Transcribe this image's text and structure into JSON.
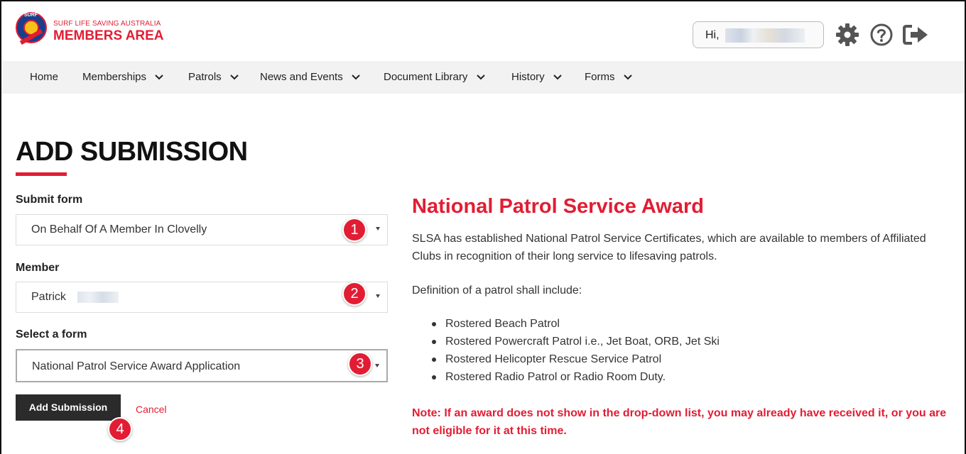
{
  "brand": {
    "sub_title": "SURF LIFE SAVING AUSTRALIA",
    "main_title": "MEMBERS AREA",
    "logo_text": "SURF"
  },
  "user": {
    "greeting": "Hi,"
  },
  "icons": {
    "settings": "gear-icon",
    "help": "question-circle-icon",
    "logout": "sign-out-icon"
  },
  "nav": {
    "items": [
      {
        "label": "Home",
        "has_dropdown": false
      },
      {
        "label": "Memberships",
        "has_dropdown": true
      },
      {
        "label": "Patrols",
        "has_dropdown": true
      },
      {
        "label": "News and Events",
        "has_dropdown": true
      },
      {
        "label": "Document Library",
        "has_dropdown": true
      },
      {
        "label": "History",
        "has_dropdown": true
      },
      {
        "label": "Forms",
        "has_dropdown": true
      }
    ]
  },
  "page": {
    "title": "ADD SUBMISSION"
  },
  "form": {
    "submit_form": {
      "label": "Submit form",
      "value": "On Behalf Of A Member In Clovelly",
      "step": "1"
    },
    "member": {
      "label": "Member",
      "value": "Patrick",
      "step": "2"
    },
    "select_form": {
      "label": "Select a form",
      "value": "National Patrol Service Award Application",
      "step": "3"
    },
    "add_button": "Add Submission",
    "add_step": "4",
    "cancel_link": "Cancel"
  },
  "info": {
    "title": "National Patrol Service Award",
    "paragraph1": "SLSA has established National Patrol Service Certificates, which are available to members of Affiliated Clubs in recognition of their long service to lifesaving patrols.",
    "paragraph2": "Definition of a patrol shall include:",
    "bullets": [
      "Rostered Beach Patrol",
      "Rostered Powercraft Patrol i.e., Jet Boat, ORB, Jet Ski",
      "Rostered Helicopter Rescue Service Patrol",
      "Rostered Radio Patrol or Radio Room Duty."
    ],
    "note": "Note: If an award does not show in the drop-down list, you may already have received it, or you are not eligible for it at this time."
  },
  "colors": {
    "accent": "#e21d33",
    "nav_bg": "#f2f2f2",
    "button_bg": "#2b2b2b"
  }
}
